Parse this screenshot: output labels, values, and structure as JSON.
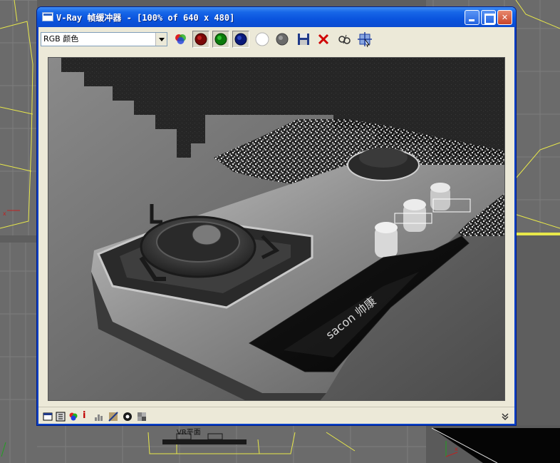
{
  "window": {
    "title": "V-Ray 帧缓冲器 - [100% of 640 x 480]",
    "minimize": "",
    "maximize": "",
    "close": "✕"
  },
  "toolbar": {
    "channel_select_value": "RGB 颜色",
    "tools": [
      {
        "name": "display-color-channels-icon"
      },
      {
        "name": "red-channel-icon",
        "color": "#b01010"
      },
      {
        "name": "green-channel-icon",
        "color": "#18a018"
      },
      {
        "name": "blue-channel-icon",
        "color": "#10208c"
      },
      {
        "name": "alpha-channel-icon",
        "color": "#ffffff"
      },
      {
        "name": "monochrome-icon",
        "color": "#6a6a6a"
      },
      {
        "name": "save-image-icon"
      },
      {
        "name": "clear-image-icon",
        "color": "#d00000"
      },
      {
        "name": "duplicate-to-max-vfb-icon"
      },
      {
        "name": "track-mouse-render-icon"
      }
    ]
  },
  "render": {
    "brand_text": "sacon 帅康"
  },
  "viewports": {
    "bottom_label": "VR平面"
  },
  "statusbar": {
    "info_glyph": "i"
  }
}
